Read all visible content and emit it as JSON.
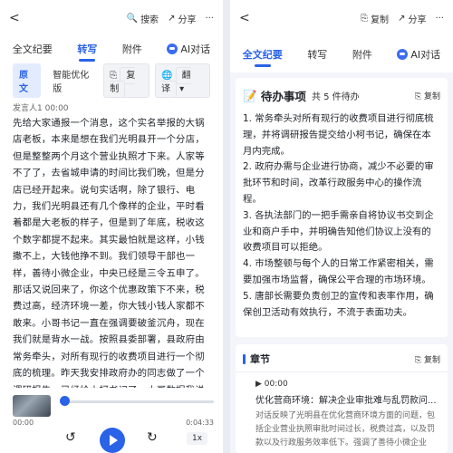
{
  "left": {
    "topbar": {
      "back": "<",
      "search": "搜索",
      "share": "分享",
      "more": "···"
    },
    "tabs": [
      "全文纪要",
      "转写",
      "附件",
      "AI对话"
    ],
    "active_tab": "转写",
    "sub": {
      "original": "原文",
      "optimized": "智能优化版",
      "copy": "复制",
      "translate": "翻译"
    },
    "speaker": "发言人1  00:00",
    "transcript": "先给大家通报一个消息，这个实名举报的大锅店老板，本来是想在我们光明县开一个分店，但是整整两个月这个营业执照才下来。人家等不了了，去省城申请的时间比我们晚，但是分店已经开起来。说句实话啊，除了银行、电力，我们光明县还有几个像样的企业，平时看着都是大老板的样子，但是到了年底，税收这个数字都提不起来。其实最怕就是这样，小钱撒不上，大钱他挣不到。我们领导干部也一样，善待小微企业，中央已经是三令五申了。那话又说回来了，你这个优惠政策下不来，税费过高，经济环境一差，你大钱小钱人家都不敢来。小哥书记一直在强调要破釜沉舟，现在我们就是背水一战。按照县委部署，县政府由常务牵头，对所有现行的收费项目进行一个彻底的梳理。昨天我安排政府办的同志做了一个调研报告，已经给小柯书记了，小哥数据我说完。",
    "player": {
      "current": "00:00",
      "total": "0:04:33",
      "speed": "1x"
    }
  },
  "right": {
    "topbar": {
      "back": "<",
      "copy": "复制",
      "share": "分享",
      "more": "···"
    },
    "tabs": [
      "全文纪要",
      "转写",
      "附件",
      "AI对话"
    ],
    "active_tab": "全文纪要",
    "todo": {
      "title": "待办事项",
      "count": "共 5 件待办",
      "copy": "复制",
      "items": [
        "1. 常务牵头对所有现行的收费项目进行彻底梳理，并将调研报告提交给小柯书记，确保在本月内完成。",
        "2. 政府办需与企业进行协商，减少不必要的审批环节和时间，改革行政服务中心的操作流程。",
        "3. 各执法部门的一把手需亲自将协议书交到企业和商户手中，并明确告知他们协议上没有的收费项目可以拒绝。",
        "4. 市场整顿与每个人的日常工作紧密相关，需要加强市场监督，确保公平合理的市场环境。",
        "5. 唐部长需要负责创卫的宣传和表率作用，确保创卫活动有效执行，不流于表面功夫。"
      ]
    },
    "chapter": {
      "title": "章节",
      "copy": "复制",
      "time": "▶ 00:00",
      "item_title": "优化营商环境：解决企业审批难与乱罚款问...",
      "summary": "对话反映了光明县在优化营商环境方面的问题，包括企业营业执照审批时间过长，税费过高，以及罚款以及行政服务效率低下。强调了善待小微企业"
    }
  },
  "colors": {
    "accent": "#2a62e8",
    "page_bg": "#e9ecf3"
  },
  "icons": [
    "back-icon",
    "search-icon",
    "share-icon",
    "more-icon",
    "copy-icon",
    "translate-icon",
    "ai-icon",
    "memo-icon",
    "play-icon",
    "rewind-icon",
    "forward-icon"
  ]
}
